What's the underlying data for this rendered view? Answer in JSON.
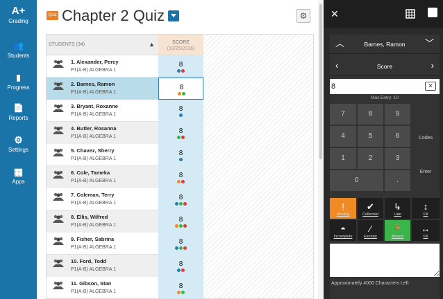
{
  "nav": {
    "items": [
      {
        "icon": "A+",
        "label": "Grading"
      },
      {
        "icon": "👥",
        "label": "Students"
      },
      {
        "icon": "▮",
        "label": "Progress"
      },
      {
        "icon": "📄",
        "label": "Reports"
      },
      {
        "icon": "⚙",
        "label": "Settings"
      },
      {
        "icon": "▦",
        "label": "Apps"
      }
    ]
  },
  "header": {
    "badge": "Quiz",
    "title": "Chapter 2 Quiz"
  },
  "grid": {
    "students_header": "STUDENTS (34)",
    "score_header": "SCORE",
    "score_date": "(10/25/2016)",
    "rows": [
      {
        "name": "1. Alexander, Percy",
        "class": "P1(A-B) ALGEBRA 1",
        "score": "8",
        "dots": [
          "#2b7bb0",
          "#e03a3a"
        ]
      },
      {
        "name": "2. Barnes, Ramon",
        "class": "P1(A-B) ALGEBRA 1",
        "score": "8",
        "dots": [
          "#f08a24",
          "#3bb54a"
        ]
      },
      {
        "name": "3. Bryant, Roxanne",
        "class": "P1(A-B) ALGEBRA 1",
        "score": "8",
        "dots": [
          "#2b7bb0"
        ]
      },
      {
        "name": "4. Butler, Rosanna",
        "class": "P1(A-B) ALGEBRA 1",
        "score": "8",
        "dots": [
          "#3bb54a",
          "#e03a3a"
        ]
      },
      {
        "name": "5. Chavez, Sherry",
        "class": "P1(A-B) ALGEBRA 1",
        "score": "8",
        "dots": [
          "#2b7bb0"
        ]
      },
      {
        "name": "6. Cole, Tameka",
        "class": "P1(A-B) ALGEBRA 1",
        "score": "8",
        "dots": [
          "#f08a24",
          "#e03a3a"
        ]
      },
      {
        "name": "7. Coleman, Terry",
        "class": "P1(A-B) ALGEBRA 1",
        "score": "8",
        "dots": [
          "#2b7bb0",
          "#3bb54a",
          "#e03a3a"
        ]
      },
      {
        "name": "8. Ellis, Wilfred",
        "class": "P1(A-B) ALGEBRA 1",
        "score": "8",
        "dots": [
          "#f08a24",
          "#3bb54a",
          "#e03a3a"
        ]
      },
      {
        "name": "9. Fisher, Sabrina",
        "class": "P1(A-B) ALGEBRA 1",
        "score": "8",
        "dots": [
          "#2b7bb0",
          "#3bb54a",
          "#e03a3a"
        ]
      },
      {
        "name": "10. Ford, Todd",
        "class": "P1(A-B) ALGEBRA 1",
        "score": "8",
        "dots": [
          "#2b7bb0",
          "#e03a3a"
        ]
      },
      {
        "name": "11. Gibson, Stan",
        "class": "P1(A-B) ALGEBRA 1",
        "score": "8",
        "dots": [
          "#f08a24",
          "#3bb54a"
        ]
      }
    ]
  },
  "panel": {
    "close": "✕",
    "student": "Barnes, Ramon",
    "field": "Score",
    "entry_value": "8",
    "backspace": "✕",
    "max_entry": "Max Entry: 10",
    "keys": [
      "7",
      "8",
      "9",
      "4",
      "5",
      "6",
      "1",
      "2",
      "3",
      "0",
      "."
    ],
    "side_keys": {
      "codes": "Codes",
      "enter": "Enter"
    },
    "actions": [
      {
        "icon": "!",
        "label": "Missing"
      },
      {
        "icon": "✔",
        "label": "Collected"
      },
      {
        "icon": "↳",
        "label": "Late"
      },
      {
        "icon": "↕",
        "label": "Fill"
      },
      {
        "icon": "◓",
        "label": "Incomplete"
      },
      {
        "icon": "∕",
        "label": "Exempt"
      },
      {
        "icon": "🪑",
        "label": "Absent"
      },
      {
        "icon": "↔",
        "label": "Fill"
      }
    ],
    "chars_left": "Approximately 4000 Characters Left"
  },
  "colors": {
    "nav": "#1a74a8",
    "missing": "#f08a24",
    "absent": "#3bb54a",
    "panel": "#2a2a2a"
  }
}
